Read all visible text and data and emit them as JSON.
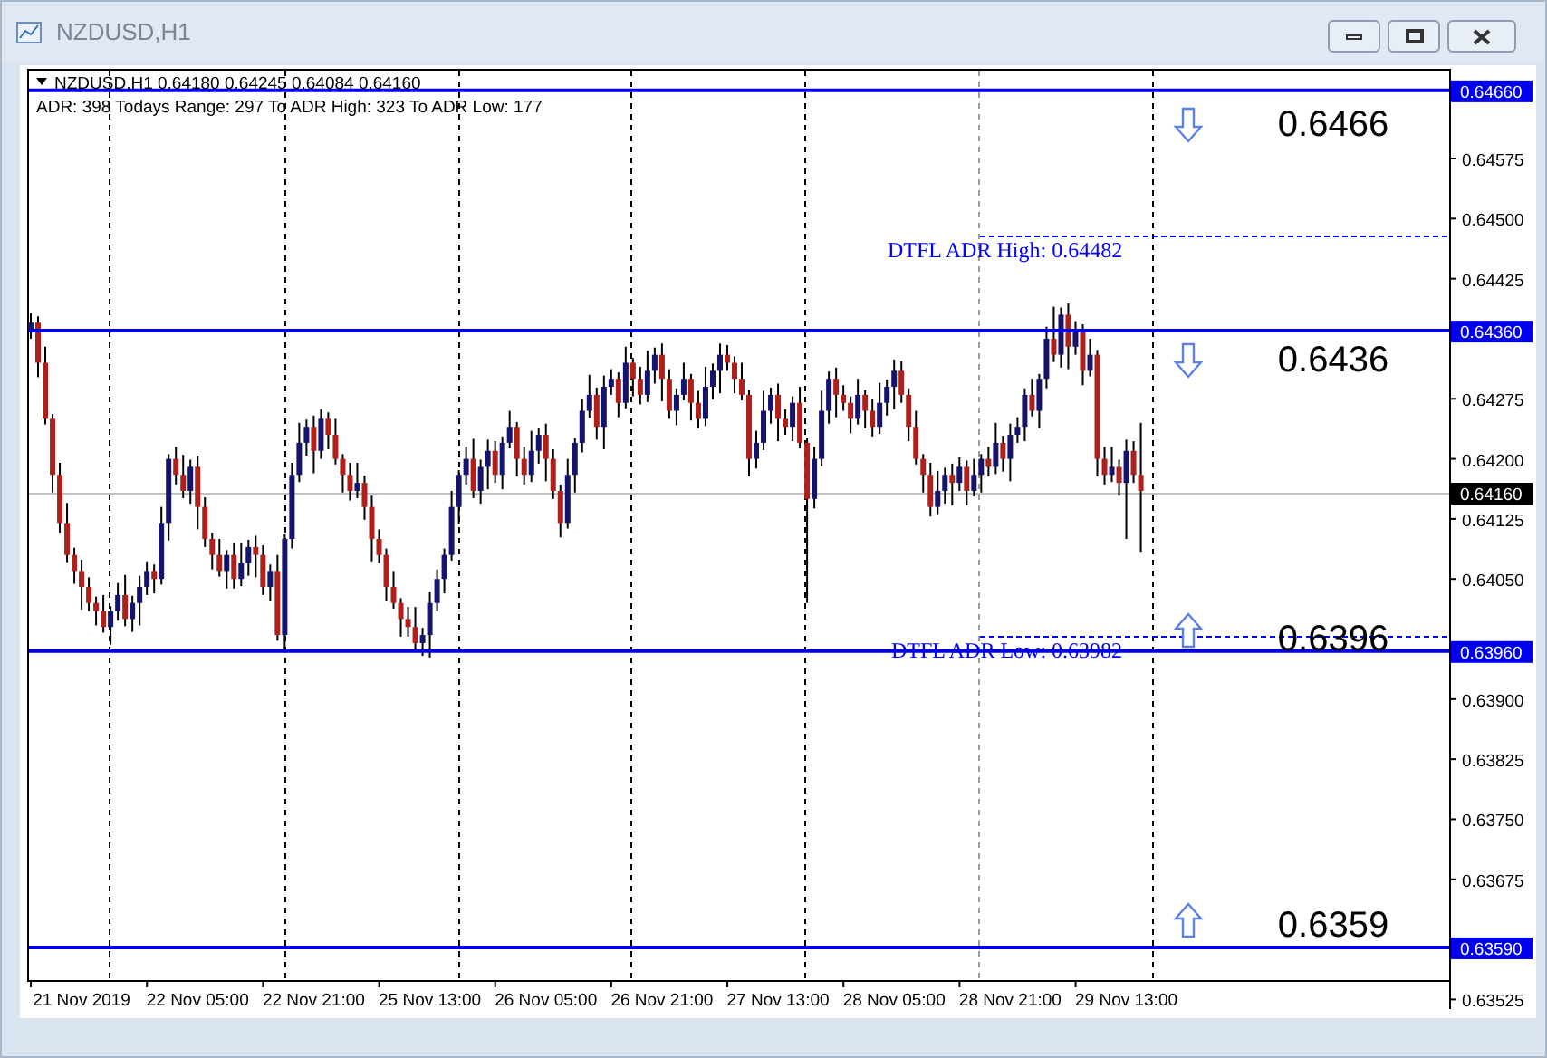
{
  "window": {
    "title": "NZDUSD,H1"
  },
  "chart": {
    "symbol_line": "NZDUSD,H1  0.64180 0.64245 0.64084 0.64160",
    "adr_line": "ADR: 398  Todays Range: 297  To ADR High: 323  To ADR Low: 177",
    "levels": [
      {
        "axis_label": "0.64660",
        "big_label": "0.6466",
        "kind": "down"
      },
      {
        "axis_label": "0.64360",
        "big_label": "0.6436",
        "kind": "down"
      },
      {
        "axis_label": "0.63960",
        "big_label": "0.6396",
        "kind": "up"
      },
      {
        "axis_label": "0.63590",
        "big_label": "0.6359",
        "kind": "up"
      }
    ],
    "adr_high": {
      "label": "DTFL ADR High: 0.64482"
    },
    "adr_low": {
      "label": "DTFL ADR Low: 0.63982"
    },
    "current_price": "0.64160",
    "chart_data": {
      "type": "candlestick",
      "categories": [
        null,
        null,
        null,
        null,
        null,
        null,
        null,
        "21 Nov 2019",
        null,
        null,
        null,
        null,
        null,
        null,
        null,
        null,
        null,
        null,
        null,
        null,
        null,
        null,
        null,
        "22 Nov 05:00",
        null,
        null,
        null,
        null,
        null,
        null,
        null,
        null,
        null,
        null,
        null,
        null,
        null,
        null,
        null,
        "22 Nov 21:00",
        null,
        null,
        null,
        null,
        null,
        null,
        null,
        null,
        null,
        null,
        null,
        null,
        null,
        null,
        null,
        "25 Nov 13:00",
        null,
        null,
        null,
        null,
        null,
        null,
        null,
        null,
        null,
        null,
        null,
        null,
        null,
        null,
        null,
        "26 Nov 05:00",
        null,
        null,
        null,
        null,
        null,
        null,
        null,
        null,
        null,
        null,
        null,
        null,
        null,
        null,
        null,
        "26 Nov 21:00",
        null,
        null,
        null,
        null,
        null,
        null,
        null,
        null,
        null,
        null,
        null,
        null,
        null,
        null,
        null,
        "27 Nov 13:00",
        null,
        null,
        null,
        null,
        null,
        null,
        null,
        null,
        null,
        null,
        null,
        null,
        null,
        null,
        null,
        "28 Nov 05:00",
        null,
        null,
        null,
        null,
        null,
        null,
        null,
        null,
        null,
        null,
        null,
        null,
        null,
        null,
        null,
        "28 Nov 21:00",
        null,
        null,
        null,
        null,
        null,
        null,
        null,
        null,
        null,
        null,
        null,
        null,
        null,
        null,
        null,
        "29 Nov 13:00",
        null,
        null,
        null,
        null,
        null,
        null,
        null,
        null,
        null,
        null,
        null,
        null,
        null,
        null,
        null,
        null,
        null,
        null,
        null,
        null,
        null,
        null,
        null,
        null,
        null,
        null,
        null,
        null,
        null,
        null,
        null,
        null,
        null,
        null,
        null,
        null,
        null,
        null,
        null,
        null,
        null,
        null,
        null,
        null
      ],
      "ylim": [
        0.63513,
        0.64687
      ],
      "ohlc": [
        [
          0.6436,
          0.64382,
          0.6435,
          0.6437
        ],
        [
          0.6437,
          0.64378,
          0.64302,
          0.6432
        ],
        [
          0.6432,
          0.6434,
          0.64243,
          0.6425
        ],
        [
          0.6425,
          0.64256,
          0.64158,
          0.6418
        ],
        [
          0.6418,
          0.64195,
          0.64108,
          0.6412
        ],
        [
          0.6412,
          0.64145,
          0.64071,
          0.6408
        ],
        [
          0.6408,
          0.64089,
          0.64044,
          0.6406
        ],
        [
          0.6406,
          0.64074,
          0.64012,
          0.6404
        ],
        [
          0.6404,
          0.64052,
          0.6401,
          0.6402
        ],
        [
          0.6402,
          0.64028,
          0.63992,
          0.6401
        ],
        [
          0.6401,
          0.6403,
          0.63983,
          0.6399
        ],
        [
          0.6399,
          0.64016,
          0.63968,
          0.6401
        ],
        [
          0.6401,
          0.64045,
          0.63998,
          0.6403
        ],
        [
          0.6403,
          0.64055,
          0.63991,
          0.64
        ],
        [
          0.64,
          0.64029,
          0.63984,
          0.6402
        ],
        [
          0.6402,
          0.64054,
          0.63992,
          0.6404
        ],
        [
          0.6404,
          0.64072,
          0.6403,
          0.6406
        ],
        [
          0.6406,
          0.64068,
          0.64032,
          0.6405
        ],
        [
          0.6405,
          0.6414,
          0.64043,
          0.6412
        ],
        [
          0.6412,
          0.64206,
          0.64098,
          0.642
        ],
        [
          0.642,
          0.64215,
          0.64168,
          0.6418
        ],
        [
          0.6418,
          0.64205,
          0.64151,
          0.6416
        ],
        [
          0.6416,
          0.64199,
          0.64144,
          0.6419
        ],
        [
          0.6419,
          0.64204,
          0.64112,
          0.6414
        ],
        [
          0.6414,
          0.64152,
          0.6409,
          0.641
        ],
        [
          0.641,
          0.64108,
          0.64062,
          0.6408
        ],
        [
          0.6408,
          0.641,
          0.64053,
          0.6406
        ],
        [
          0.6406,
          0.64086,
          0.64038,
          0.6408
        ],
        [
          0.6408,
          0.64095,
          0.64038,
          0.6405
        ],
        [
          0.6405,
          0.64095,
          0.64041,
          0.6407
        ],
        [
          0.6407,
          0.64099,
          0.64054,
          0.6409
        ],
        [
          0.6409,
          0.64104,
          0.64052,
          0.6408
        ],
        [
          0.6408,
          0.64092,
          0.6403,
          0.6404
        ],
        [
          0.6404,
          0.64068,
          0.64022,
          0.6406
        ],
        [
          0.6406,
          0.6408,
          0.63973,
          0.6398
        ],
        [
          0.6398,
          0.64106,
          0.63958,
          0.641
        ],
        [
          0.641,
          0.64195,
          0.64088,
          0.6418
        ],
        [
          0.6418,
          0.64245,
          0.64171,
          0.6422
        ],
        [
          0.6422,
          0.64249,
          0.64204,
          0.6424
        ],
        [
          0.6424,
          0.64254,
          0.64182,
          0.6421
        ],
        [
          0.6421,
          0.64262,
          0.642,
          0.6425
        ],
        [
          0.6425,
          0.64258,
          0.64212,
          0.6423
        ],
        [
          0.6423,
          0.6425,
          0.64193,
          0.642
        ],
        [
          0.642,
          0.64206,
          0.64158,
          0.6418
        ],
        [
          0.6418,
          0.64195,
          0.64148,
          0.6416
        ],
        [
          0.6416,
          0.64195,
          0.64151,
          0.6417
        ],
        [
          0.6417,
          0.64179,
          0.64124,
          0.6414
        ],
        [
          0.6414,
          0.64154,
          0.64072,
          0.641
        ],
        [
          0.641,
          0.64112,
          0.6407,
          0.6408
        ],
        [
          0.6408,
          0.64088,
          0.64022,
          0.6404
        ],
        [
          0.6404,
          0.6406,
          0.64013,
          0.6402
        ],
        [
          0.6402,
          0.64026,
          0.63978,
          0.64
        ],
        [
          0.64,
          0.64015,
          0.63978,
          0.6399
        ],
        [
          0.6399,
          0.64015,
          0.63961,
          0.6397
        ],
        [
          0.6397,
          0.63989,
          0.63954,
          0.6398
        ],
        [
          0.6398,
          0.64034,
          0.63952,
          0.6402
        ],
        [
          0.6402,
          0.64062,
          0.6401,
          0.6405
        ],
        [
          0.6405,
          0.64088,
          0.64032,
          0.6408
        ],
        [
          0.6408,
          0.6416,
          0.64073,
          0.6414
        ],
        [
          0.6414,
          0.64186,
          0.64118,
          0.6418
        ],
        [
          0.6418,
          0.64215,
          0.64168,
          0.642
        ],
        [
          0.642,
          0.64225,
          0.64151,
          0.6416
        ],
        [
          0.6416,
          0.64199,
          0.64144,
          0.6419
        ],
        [
          0.6419,
          0.64224,
          0.64162,
          0.6421
        ],
        [
          0.6421,
          0.64222,
          0.6417,
          0.6418
        ],
        [
          0.6418,
          0.64228,
          0.64162,
          0.6422
        ],
        [
          0.6422,
          0.6426,
          0.64213,
          0.6424
        ],
        [
          0.6424,
          0.64246,
          0.64178,
          0.642
        ],
        [
          0.642,
          0.64215,
          0.64168,
          0.6418
        ],
        [
          0.6418,
          0.64235,
          0.64171,
          0.6421
        ],
        [
          0.6421,
          0.64239,
          0.64194,
          0.6423
        ],
        [
          0.6423,
          0.64244,
          0.64172,
          0.642
        ],
        [
          0.642,
          0.64212,
          0.6415,
          0.6416
        ],
        [
          0.6416,
          0.64168,
          0.64102,
          0.6412
        ],
        [
          0.6412,
          0.642,
          0.64113,
          0.6418
        ],
        [
          0.6418,
          0.64226,
          0.64158,
          0.6422
        ],
        [
          0.6422,
          0.64275,
          0.64208,
          0.6426
        ],
        [
          0.6426,
          0.64305,
          0.64251,
          0.6428
        ],
        [
          0.6428,
          0.64289,
          0.64224,
          0.6424
        ],
        [
          0.6424,
          0.64304,
          0.64212,
          0.6429
        ],
        [
          0.6429,
          0.64312,
          0.6428,
          0.643
        ],
        [
          0.643,
          0.64308,
          0.64252,
          0.6427
        ],
        [
          0.6427,
          0.6434,
          0.64263,
          0.6432
        ],
        [
          0.6432,
          0.64326,
          0.64278,
          0.643
        ],
        [
          0.643,
          0.64315,
          0.64268,
          0.6428
        ],
        [
          0.6428,
          0.64335,
          0.64271,
          0.6431
        ],
        [
          0.6431,
          0.64339,
          0.64294,
          0.6433
        ],
        [
          0.6433,
          0.64344,
          0.64272,
          0.643
        ],
        [
          0.643,
          0.64312,
          0.6425,
          0.6426
        ],
        [
          0.6426,
          0.64288,
          0.64242,
          0.6428
        ],
        [
          0.6428,
          0.6432,
          0.64273,
          0.643
        ],
        [
          0.643,
          0.64306,
          0.64248,
          0.6427
        ],
        [
          0.6427,
          0.64285,
          0.64238,
          0.6425
        ],
        [
          0.6425,
          0.64315,
          0.64241,
          0.6429
        ],
        [
          0.6429,
          0.64319,
          0.64274,
          0.6431
        ],
        [
          0.6431,
          0.64344,
          0.64282,
          0.6433
        ],
        [
          0.6433,
          0.64342,
          0.6431,
          0.6432
        ],
        [
          0.6432,
          0.64328,
          0.64282,
          0.643
        ],
        [
          0.643,
          0.6432,
          0.64273,
          0.6428
        ],
        [
          0.6428,
          0.64286,
          0.64178,
          0.642
        ],
        [
          0.642,
          0.64235,
          0.64188,
          0.6422
        ],
        [
          0.6422,
          0.64285,
          0.64211,
          0.6426
        ],
        [
          0.6426,
          0.64289,
          0.64244,
          0.6428
        ],
        [
          0.6428,
          0.64294,
          0.64222,
          0.6425
        ],
        [
          0.6425,
          0.64262,
          0.6423,
          0.6424
        ],
        [
          0.6424,
          0.64278,
          0.64222,
          0.6427
        ],
        [
          0.6427,
          0.6429,
          0.64213,
          0.6422
        ],
        [
          0.6422,
          0.64226,
          0.6402,
          0.6415
        ],
        [
          0.6415,
          0.64215,
          0.64138,
          0.642
        ],
        [
          0.642,
          0.64285,
          0.64191,
          0.6426
        ],
        [
          0.6426,
          0.64309,
          0.64244,
          0.643
        ],
        [
          0.643,
          0.64314,
          0.64252,
          0.6428
        ],
        [
          0.6428,
          0.64292,
          0.6426,
          0.6427
        ],
        [
          0.6427,
          0.64278,
          0.64232,
          0.6425
        ],
        [
          0.6425,
          0.643,
          0.64243,
          0.6428
        ],
        [
          0.6428,
          0.64286,
          0.64238,
          0.6426
        ],
        [
          0.6426,
          0.64275,
          0.64228,
          0.6424
        ],
        [
          0.6424,
          0.64295,
          0.64231,
          0.6427
        ],
        [
          0.6427,
          0.64299,
          0.64254,
          0.6429
        ],
        [
          0.6429,
          0.64324,
          0.64262,
          0.6431
        ],
        [
          0.6431,
          0.64322,
          0.6427,
          0.6428
        ],
        [
          0.6428,
          0.64288,
          0.64222,
          0.6424
        ],
        [
          0.6424,
          0.6426,
          0.64193,
          0.642
        ],
        [
          0.642,
          0.64206,
          0.64158,
          0.6418
        ],
        [
          0.6418,
          0.64195,
          0.64128,
          0.6414
        ],
        [
          0.6414,
          0.64185,
          0.64131,
          0.6416
        ],
        [
          0.6416,
          0.64189,
          0.64144,
          0.6418
        ],
        [
          0.6418,
          0.64194,
          0.64142,
          0.6417
        ],
        [
          0.6417,
          0.64202,
          0.6416,
          0.6419
        ],
        [
          0.6419,
          0.64198,
          0.64142,
          0.6416
        ],
        [
          0.6416,
          0.642,
          0.64153,
          0.6418
        ],
        [
          0.6418,
          0.64206,
          0.64158,
          0.642
        ],
        [
          0.642,
          0.64215,
          0.64178,
          0.6419
        ],
        [
          0.6419,
          0.64245,
          0.64181,
          0.6422
        ],
        [
          0.6422,
          0.64229,
          0.64184,
          0.642
        ],
        [
          0.642,
          0.64244,
          0.64172,
          0.6423
        ],
        [
          0.6423,
          0.64252,
          0.6422,
          0.6424
        ],
        [
          0.6424,
          0.64288,
          0.64222,
          0.6428
        ],
        [
          0.6428,
          0.643,
          0.64253,
          0.6426
        ],
        [
          0.6426,
          0.64306,
          0.64238,
          0.643
        ],
        [
          0.643,
          0.64365,
          0.64288,
          0.6435
        ],
        [
          0.6435,
          0.6439,
          0.64321,
          0.6433
        ],
        [
          0.6433,
          0.64389,
          0.64314,
          0.6438
        ],
        [
          0.6438,
          0.64394,
          0.64312,
          0.6434
        ],
        [
          0.6434,
          0.64372,
          0.6433,
          0.6436
        ],
        [
          0.6436,
          0.64368,
          0.64292,
          0.6431
        ],
        [
          0.6431,
          0.6435,
          0.64303,
          0.6433
        ],
        [
          0.6433,
          0.64336,
          0.64178,
          0.642
        ],
        [
          0.642,
          0.64215,
          0.64168,
          0.6418
        ],
        [
          0.6418,
          0.64215,
          0.64171,
          0.6419
        ],
        [
          0.6419,
          0.64199,
          0.64154,
          0.6417
        ],
        [
          0.6417,
          0.64224,
          0.641,
          0.6421
        ],
        [
          0.6421,
          0.64222,
          0.6417,
          0.6418
        ],
        [
          0.6418,
          0.64245,
          0.64084,
          0.6416
        ],
        null,
        null,
        null,
        null,
        null,
        null,
        null,
        null,
        null,
        null,
        null,
        null,
        null,
        null,
        null,
        null,
        null,
        null,
        null,
        null,
        null,
        null,
        null,
        null,
        null,
        null,
        null,
        null,
        null,
        null,
        null,
        null,
        null,
        null,
        null,
        null,
        null,
        null,
        null,
        null,
        null,
        null
      ],
      "yticks": [
        {
          "value": 0.64575,
          "label": "0.64575"
        },
        {
          "value": 0.645,
          "label": "0.64500"
        },
        {
          "value": 0.64425,
          "label": "0.64425"
        },
        {
          "value": 0.64275,
          "label": "0.64275"
        },
        {
          "value": 0.642,
          "label": "0.64200"
        },
        {
          "value": 0.64125,
          "label": "0.64125"
        },
        {
          "value": 0.6405,
          "label": "0.64050"
        },
        {
          "value": 0.639,
          "label": "0.63900"
        },
        {
          "value": 0.63825,
          "label": "0.63825"
        },
        {
          "value": 0.6375,
          "label": "0.63750"
        },
        {
          "value": 0.63675,
          "label": "0.63675"
        },
        {
          "value": 0.63525,
          "label": "0.63525"
        }
      ]
    }
  }
}
